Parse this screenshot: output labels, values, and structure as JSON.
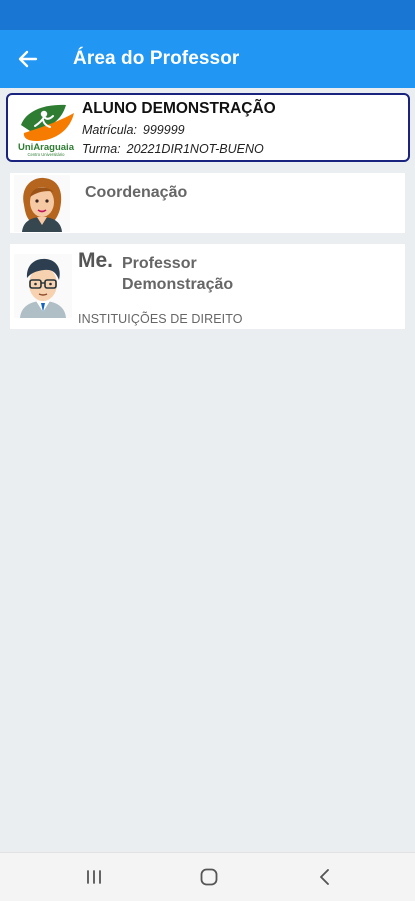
{
  "app_bar": {
    "title": "Área do Professor",
    "back_icon": "arrow-left-icon",
    "color": "#2196f3"
  },
  "status_bar": {
    "color": "#1976d2"
  },
  "student": {
    "name": "ALUNO DEMONSTRAÇÃO",
    "registration_label": "Matrícula:",
    "registration_value": "999999",
    "class_label": "Turma:",
    "class_value": "20221DIR1NOT-BUENO",
    "logo_text": "UniAraguaia",
    "logo_subtext": "Centro Universitário",
    "border_color": "#1a237e"
  },
  "coordination": {
    "label": "Coordenação",
    "avatar_icon": "female-avatar-icon"
  },
  "professor": {
    "title": "Me.",
    "name": "Professor Demonstração",
    "subject": "INSTITUIÇÕES DE DIREITO",
    "avatar_icon": "male-avatar-icon"
  },
  "nav_bar": {
    "recents_icon": "recents-icon",
    "home_icon": "home-icon",
    "back_icon": "nav-back-icon"
  }
}
